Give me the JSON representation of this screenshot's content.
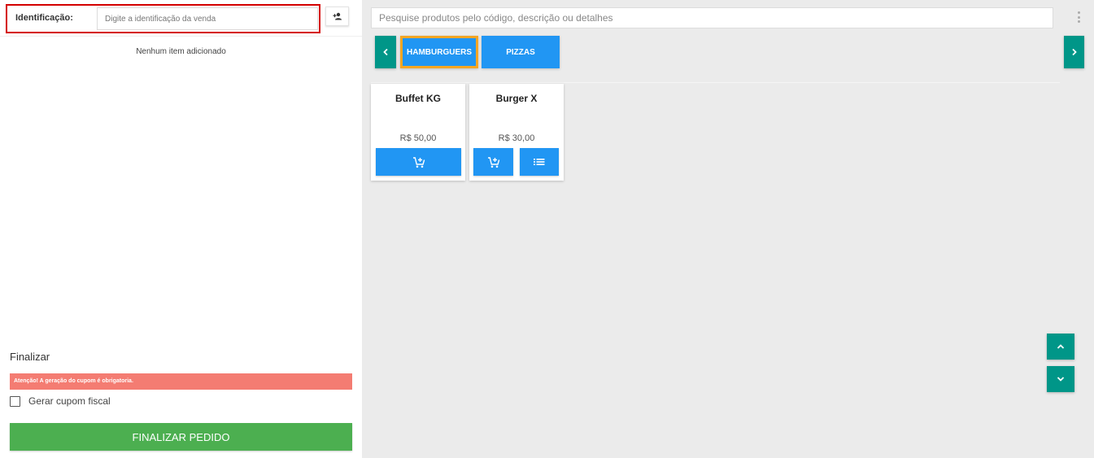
{
  "identification": {
    "label": "Identificação:",
    "placeholder": "Digite a identificação da venda",
    "value": ""
  },
  "cart": {
    "empty_message": "Nenhum item adicionado"
  },
  "finalize": {
    "title": "Finalizar",
    "alert": "Atenção! A geração do cupom é obrigatoria.",
    "coupon_label": "Gerar cupom fiscal",
    "coupon_checked": false,
    "button_label": "FINALIZAR PEDIDO"
  },
  "search": {
    "placeholder": "Pesquise produtos pelo código, descrição ou detalhes",
    "value": ""
  },
  "categories": [
    {
      "label": "HAMBURGUERS",
      "selected": true
    },
    {
      "label": "PIZZAS",
      "selected": false
    }
  ],
  "products": [
    {
      "name": "Buffet KG",
      "price": "R$ 50,00"
    },
    {
      "name": "Burger X",
      "price": "R$ 30,00"
    }
  ],
  "icons": {
    "customer": "person-add-icon",
    "cart": "add-shopping-cart-icon",
    "details": "list-icon",
    "prev": "chevron-left-icon",
    "next": "chevron-right-icon",
    "up": "chevron-up-icon",
    "down": "chevron-down-icon",
    "menu": "more-vertical-icon"
  },
  "colors": {
    "primary_blue": "#2196f3",
    "teal": "#009688",
    "success_green": "#4caf50",
    "alert_red": "#f47c72",
    "selected_outline": "#f5a623",
    "highlight_border": "#d40000"
  }
}
